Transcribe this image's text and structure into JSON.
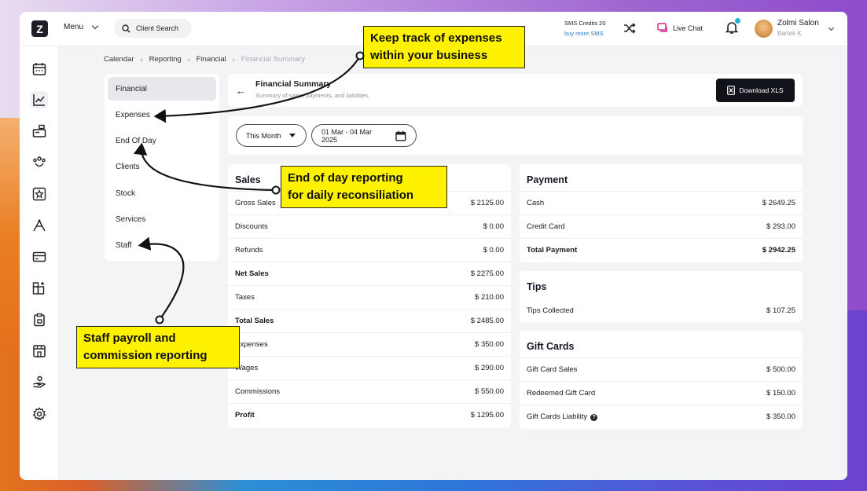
{
  "topbar": {
    "logo_letter": "Z",
    "menu_label": "Menu",
    "search_label": "Client Search",
    "sms_credits": "SMS Credits 20",
    "buy_more": "buy more SMS",
    "live_chat": "Live Chat",
    "user_name": "Zolmi Salon",
    "user_sub": "Bartek K"
  },
  "breadcrumb": {
    "items": [
      "Calendar",
      "Reporting",
      "Financial",
      "Financial Summary"
    ]
  },
  "subnav": {
    "items": [
      "Financial",
      "Expenses",
      "End Of Day",
      "Clients",
      "Stock",
      "Services",
      "Staff"
    ]
  },
  "header": {
    "title": "Financial Summary",
    "subtitle": "Summary of sales, payments, and liabilities",
    "download": "Download XLS"
  },
  "filters": {
    "period": "This Month",
    "date_range": "01 Mar - 04 Mar 2025"
  },
  "sales": {
    "title": "Sales",
    "rows": [
      {
        "label": "Gross Sales",
        "value": "$ 2125.00"
      },
      {
        "label": "Discounts",
        "value": "$ 0.00"
      },
      {
        "label": "Refunds",
        "value": "$ 0.00"
      },
      {
        "label": "Net Sales",
        "value": "$ 2275.00"
      },
      {
        "label": "Taxes",
        "value": "$ 210.00"
      },
      {
        "label": "Total Sales",
        "value": "$ 2485.00"
      },
      {
        "label": "Expenses",
        "value": "$ 350.00"
      },
      {
        "label": "Wages",
        "value": "$ 290.00"
      },
      {
        "label": "Commissions",
        "value": "$ 550.00"
      },
      {
        "label": "Profit",
        "value": "$ 1295.00"
      }
    ]
  },
  "payment": {
    "title": "Payment",
    "rows": [
      {
        "label": "Cash",
        "value": "$ 2649.25"
      },
      {
        "label": "Credit Card",
        "value": "$ 293.00"
      },
      {
        "label": "Total Payment",
        "value": "$ 2942.25"
      }
    ]
  },
  "tips": {
    "title": "Tips",
    "rows": [
      {
        "label": "Tips Collected",
        "value": "$ 107.25"
      }
    ]
  },
  "gift_cards": {
    "title": "Gift Cards",
    "rows": [
      {
        "label": "Gift Card Sales",
        "value": "$ 500.00"
      },
      {
        "label": "Redeemed Gift Card",
        "value": "$ 150.00"
      },
      {
        "label": "Gift Cards Liability",
        "value": "$ 350.00"
      }
    ]
  },
  "callouts": {
    "expenses": [
      "Keep track of expenses",
      "within your business"
    ],
    "end_of_day": [
      "End of day reporting",
      "for daily reconsiliation"
    ],
    "staff": [
      "Staff payroll and",
      "commission reporting"
    ]
  },
  "colors": {
    "callout_yellow": "#fff200",
    "button_dark": "#12131a",
    "bell_dot": "#1fb5d6",
    "live_chat_icon": "#d42a8c"
  }
}
